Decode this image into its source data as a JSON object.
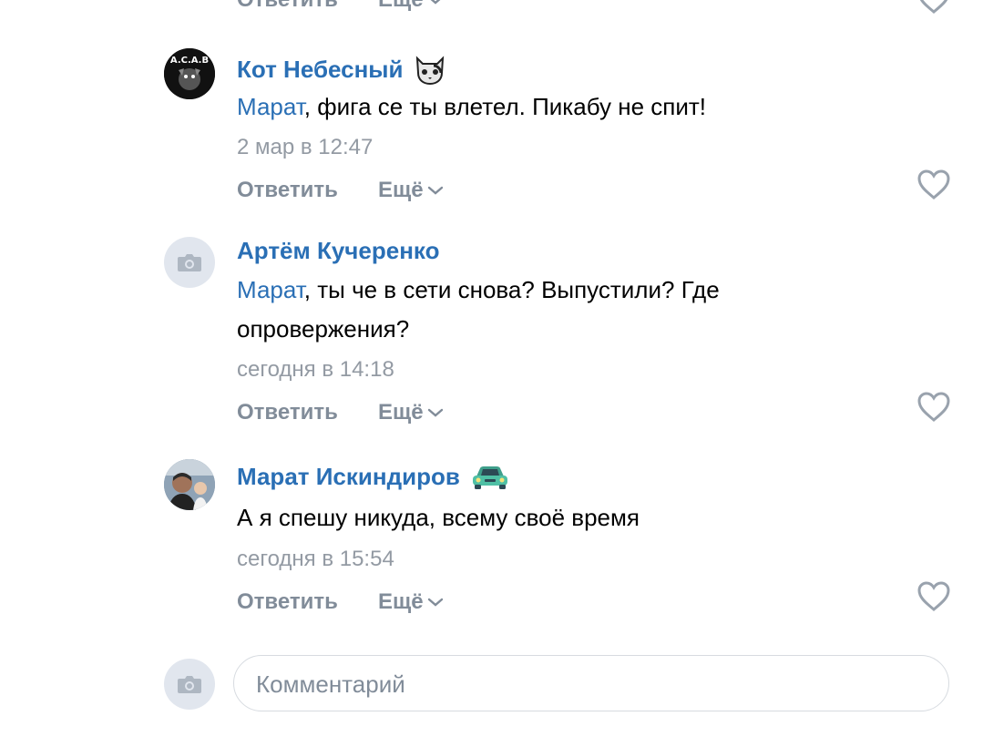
{
  "top_partial": {
    "reply": "Ответить",
    "more": "Ещё"
  },
  "comments": [
    {
      "author": "Кот Небесный",
      "author_badge": "cat-emoji",
      "mention": "Марат",
      "text": ", фига се ты влетел. Пикабу не спит!",
      "time": "2 мар в 12:47",
      "reply": "Ответить",
      "more": "Ещё"
    },
    {
      "author": "Артём Кучеренко",
      "mention": "Марат",
      "text": ", ты че в сети снова? Выпустили? Где опровержения?",
      "time": "сегодня в 14:18",
      "reply": "Ответить",
      "more": "Ещё"
    },
    {
      "author": "Марат Искиндиров",
      "author_badge": "car-emoji",
      "text": "А я спешу никуда, всему своё время",
      "time": "сегодня в 15:54",
      "reply": "Ответить",
      "more": "Ещё"
    }
  ],
  "composer": {
    "placeholder": "Комментарий"
  },
  "colors": {
    "link": "#2a6fb5",
    "meta": "#939aa3",
    "action": "#818c99",
    "like": "#99a2ad"
  }
}
